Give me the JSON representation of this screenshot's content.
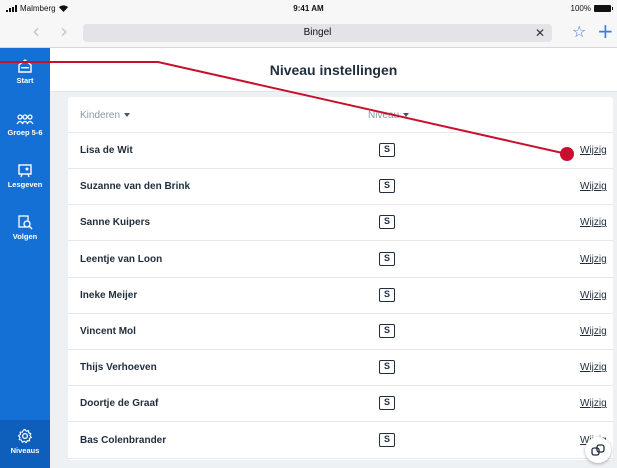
{
  "status_bar": {
    "carrier": "Malmberg",
    "time": "9:41 AM",
    "battery": "100%"
  },
  "browser": {
    "back_icon": "chevron-left-icon",
    "forward_icon": "chevron-right-icon",
    "url": "Bingel",
    "clear_icon": "close-icon",
    "bookmark_icon": "star-icon",
    "new_tab_icon": "plus-icon"
  },
  "sidebar": {
    "items": [
      {
        "label": "Start",
        "icon": "home-icon"
      },
      {
        "label": "Groep 5-6",
        "icon": "group-icon"
      },
      {
        "label": "Lesgeven",
        "icon": "teach-icon"
      },
      {
        "label": "Volgen",
        "icon": "track-icon"
      },
      {
        "label": "Niveaus",
        "icon": "gear-icon"
      }
    ]
  },
  "page": {
    "title": "Niveau instellingen"
  },
  "table": {
    "columns": [
      "Kinderen",
      "Niveau"
    ],
    "rows": [
      {
        "name": "Lisa de Wit",
        "level": "S",
        "action": "Wijzig"
      },
      {
        "name": "Suzanne van den Brink",
        "level": "S",
        "action": "Wijzig"
      },
      {
        "name": "Sanne Kuipers",
        "level": "S",
        "action": "Wijzig"
      },
      {
        "name": "Leentje van Loon",
        "level": "S",
        "action": "Wijzig"
      },
      {
        "name": "Ineke Meijer",
        "level": "S",
        "action": "Wijzig"
      },
      {
        "name": "Vincent Mol",
        "level": "S",
        "action": "Wijzig"
      },
      {
        "name": "Thijs Verhoeven",
        "level": "S",
        "action": "Wijzig"
      },
      {
        "name": "Doortje de Graaf",
        "level": "S",
        "action": "Wijzig"
      },
      {
        "name": "Bas Colenbrander",
        "level": "S",
        "action": "Wijzig"
      }
    ]
  },
  "colors": {
    "sidebar": "#1570d6",
    "pointer": "#c8102e"
  }
}
